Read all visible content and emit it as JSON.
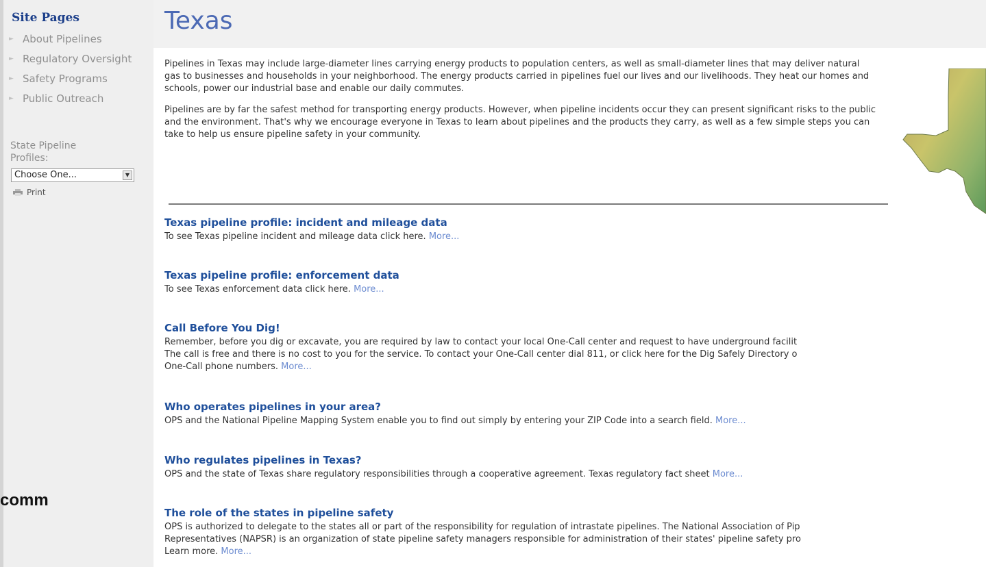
{
  "sidebar": {
    "title": "Site Pages",
    "nav": [
      {
        "label": "About Pipelines"
      },
      {
        "label": "Regulatory Oversight"
      },
      {
        "label": "Safety Programs"
      },
      {
        "label": "Public Outreach"
      }
    ],
    "state_label": "State Pipeline Profiles:",
    "select_value": "Choose One...",
    "print_label": "Print"
  },
  "overlay_text": "comm",
  "page": {
    "title": "Texas",
    "intro": [
      "Pipelines in Texas may include large-diameter lines carrying energy products to population centers, as well as small-diameter lines that may deliver natural gas to businesses and households in your neighborhood. The energy products carried in pipelines fuel our lives and our livelihoods. They heat our homes and schools, power our industrial base and enable our daily commutes.",
      "Pipelines are by far the safest method for transporting energy products. However, when pipeline incidents occur they can present significant risks to the public and the environment. That's why we encourage everyone in Texas to learn about pipelines and the products they carry, as well as a few simple steps you can take to help us ensure pipeline safety in your community."
    ],
    "more_label": "More...",
    "sections": [
      {
        "heading": "Texas pipeline profile: incident and mileage data",
        "lines": [
          "To see Texas pipeline incident and mileage data click here."
        ]
      },
      {
        "heading": "Texas pipeline profile: enforcement data",
        "lines": [
          "To see Texas enforcement data click here."
        ]
      },
      {
        "heading": "Call Before You Dig!",
        "lines": [
          "Remember, before you dig or excavate, you are required by law to contact your local One-Call center and request to have underground facilit",
          "The call is free and there is no cost to you for the service. To contact your One-Call center dial 811, or click here for the Dig Safely Directory o",
          "One-Call phone numbers."
        ]
      },
      {
        "heading": "Who operates pipelines in your area?",
        "lines": [
          "OPS and the National Pipeline Mapping System enable you to find out simply by entering your ZIP Code into a search field."
        ]
      },
      {
        "heading": "Who regulates pipelines in Texas?",
        "lines": [
          "OPS and the state of Texas share regulatory responsibilities through a cooperative agreement. Texas regulatory fact sheet"
        ]
      },
      {
        "heading": "The role of the states in pipeline safety",
        "lines": [
          "OPS is authorized to delegate to the states all or part of the responsibility for regulation of intrastate pipelines. The National Association of Pip",
          "Representatives (NAPSR) is an organization of state pipeline safety managers responsible for administration of their states' pipeline safety pro",
          "Learn more."
        ]
      }
    ]
  }
}
